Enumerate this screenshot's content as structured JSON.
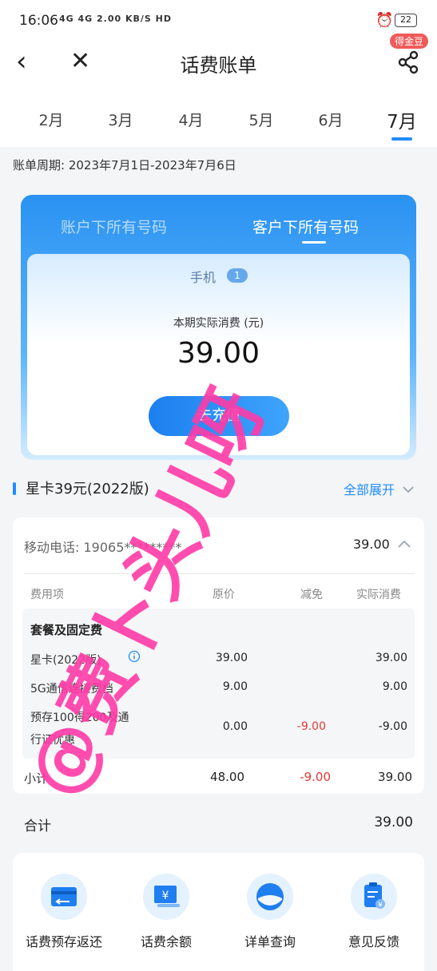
{
  "status": {
    "time": "16:06",
    "network": "4G 4G 2.00 KB/S HD",
    "battery": "22"
  },
  "nav": {
    "back": "‹",
    "close": "✕",
    "title": "话费账单",
    "badge": "得金豆"
  },
  "months": [
    "2月",
    "3月",
    "4月",
    "5月",
    "6月",
    "7月"
  ],
  "active_month": "7月",
  "period": "账单周期: 2023年7月1日-2023年7月6日",
  "summary": {
    "tab_account": "账户下所有号码",
    "tab_customer": "客户下所有号码",
    "phone_tab": "手机",
    "phone_count": "1",
    "consume_label": "本期实际消费 (元)",
    "consume_amount": "39.00",
    "recharge_label": "去充值"
  },
  "plan": {
    "name": "星卡39元(2022版)",
    "expand_label": "全部展开"
  },
  "bill": {
    "mobile_label": "移动电话: 19065*********",
    "mobile_amount": "39.00",
    "headers": [
      "费用项",
      "原价",
      "减免",
      "实际消费"
    ],
    "section_title": "套餐及固定费",
    "rows": [
      {
        "name": "星卡(2022版)",
        "orig": "39.00",
        "discount": "",
        "actual": "39.00"
      },
      {
        "name": "5G通信连接费档",
        "orig": "9.00",
        "discount": "",
        "actual": "9.00"
      },
      {
        "name_line1": "预存100得200及通",
        "name_line2": "行证优惠",
        "orig": "0.00",
        "discount": "-9.00",
        "actual": "-9.00"
      }
    ],
    "subtotal": {
      "label": "小计",
      "orig": "48.00",
      "discount": "-9.00",
      "actual": "39.00"
    }
  },
  "total": {
    "label": "合计",
    "value": "39.00"
  },
  "actions": [
    {
      "label": "话费预存返还",
      "icon": "card-return-icon"
    },
    {
      "label": "话费余额",
      "icon": "yuan-wallet-icon"
    },
    {
      "label": "详单查询",
      "icon": "bowl-search-icon"
    },
    {
      "label": "意见反馈",
      "icon": "clipboard-yuan-icon"
    }
  ],
  "watermark": "@费卜头儿呀",
  "colors": {
    "accent": "#1f8cff",
    "negative": "#e53935",
    "watermark": "#ff3aa6"
  }
}
